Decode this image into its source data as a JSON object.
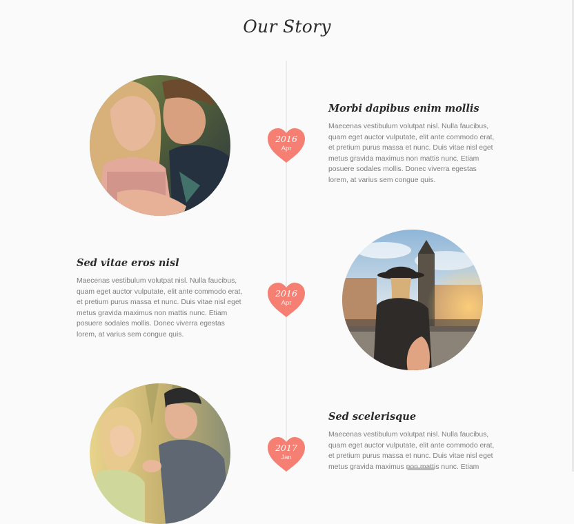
{
  "page": {
    "title": "Our Story"
  },
  "colors": {
    "accent": "#f57f73",
    "line": "#ececec",
    "text": "#2a2a2a",
    "body_text": "#7d7d7d"
  },
  "timeline": [
    {
      "title": "Morbi dapibus enim mollis",
      "year": "2016",
      "month": "Apr",
      "body": "Maecenas vestibulum volutpat nisl. Nulla faucibus, quam eget auctor vulputate, elit ante commodo erat, et pretium purus massa et nunc. Duis vitae nisl eget metus gravida maximus non mattis nunc. Etiam posuere sodales mollis. Donec viverra egestas lorem, at varius sem congue quis.",
      "photo": "couple-embracing-photo"
    },
    {
      "title": "Sed vitae eros nisl",
      "year": "2016",
      "month": "Apr",
      "body": "Maecenas vestibulum volutpat nisl. Nulla faucibus, quam eget auctor vulputate, elit ante commodo erat, et pretium purus massa et nunc. Duis vitae nisl eget metus gravida maximus non mattis nunc. Etiam posuere sodales mollis. Donec viverra egestas lorem, at varius sem congue quis.",
      "photo": "woman-leading-hand-city-photo"
    },
    {
      "title": "Sed scelerisque",
      "year": "2017",
      "month": "Jan",
      "body": "Maecenas vestibulum volutpat nisl. Nulla faucibus, quam eget auctor vulputate, elit ante commodo erat, et pretium purus massa et nunc. Duis vitae nisl eget metus gravida maximus non mattis nunc. Etiam posuere sodales mollis. Donec viverra egestas lorem, at varius sem congue quis.",
      "photo": "proposal-ring-photo"
    }
  ]
}
